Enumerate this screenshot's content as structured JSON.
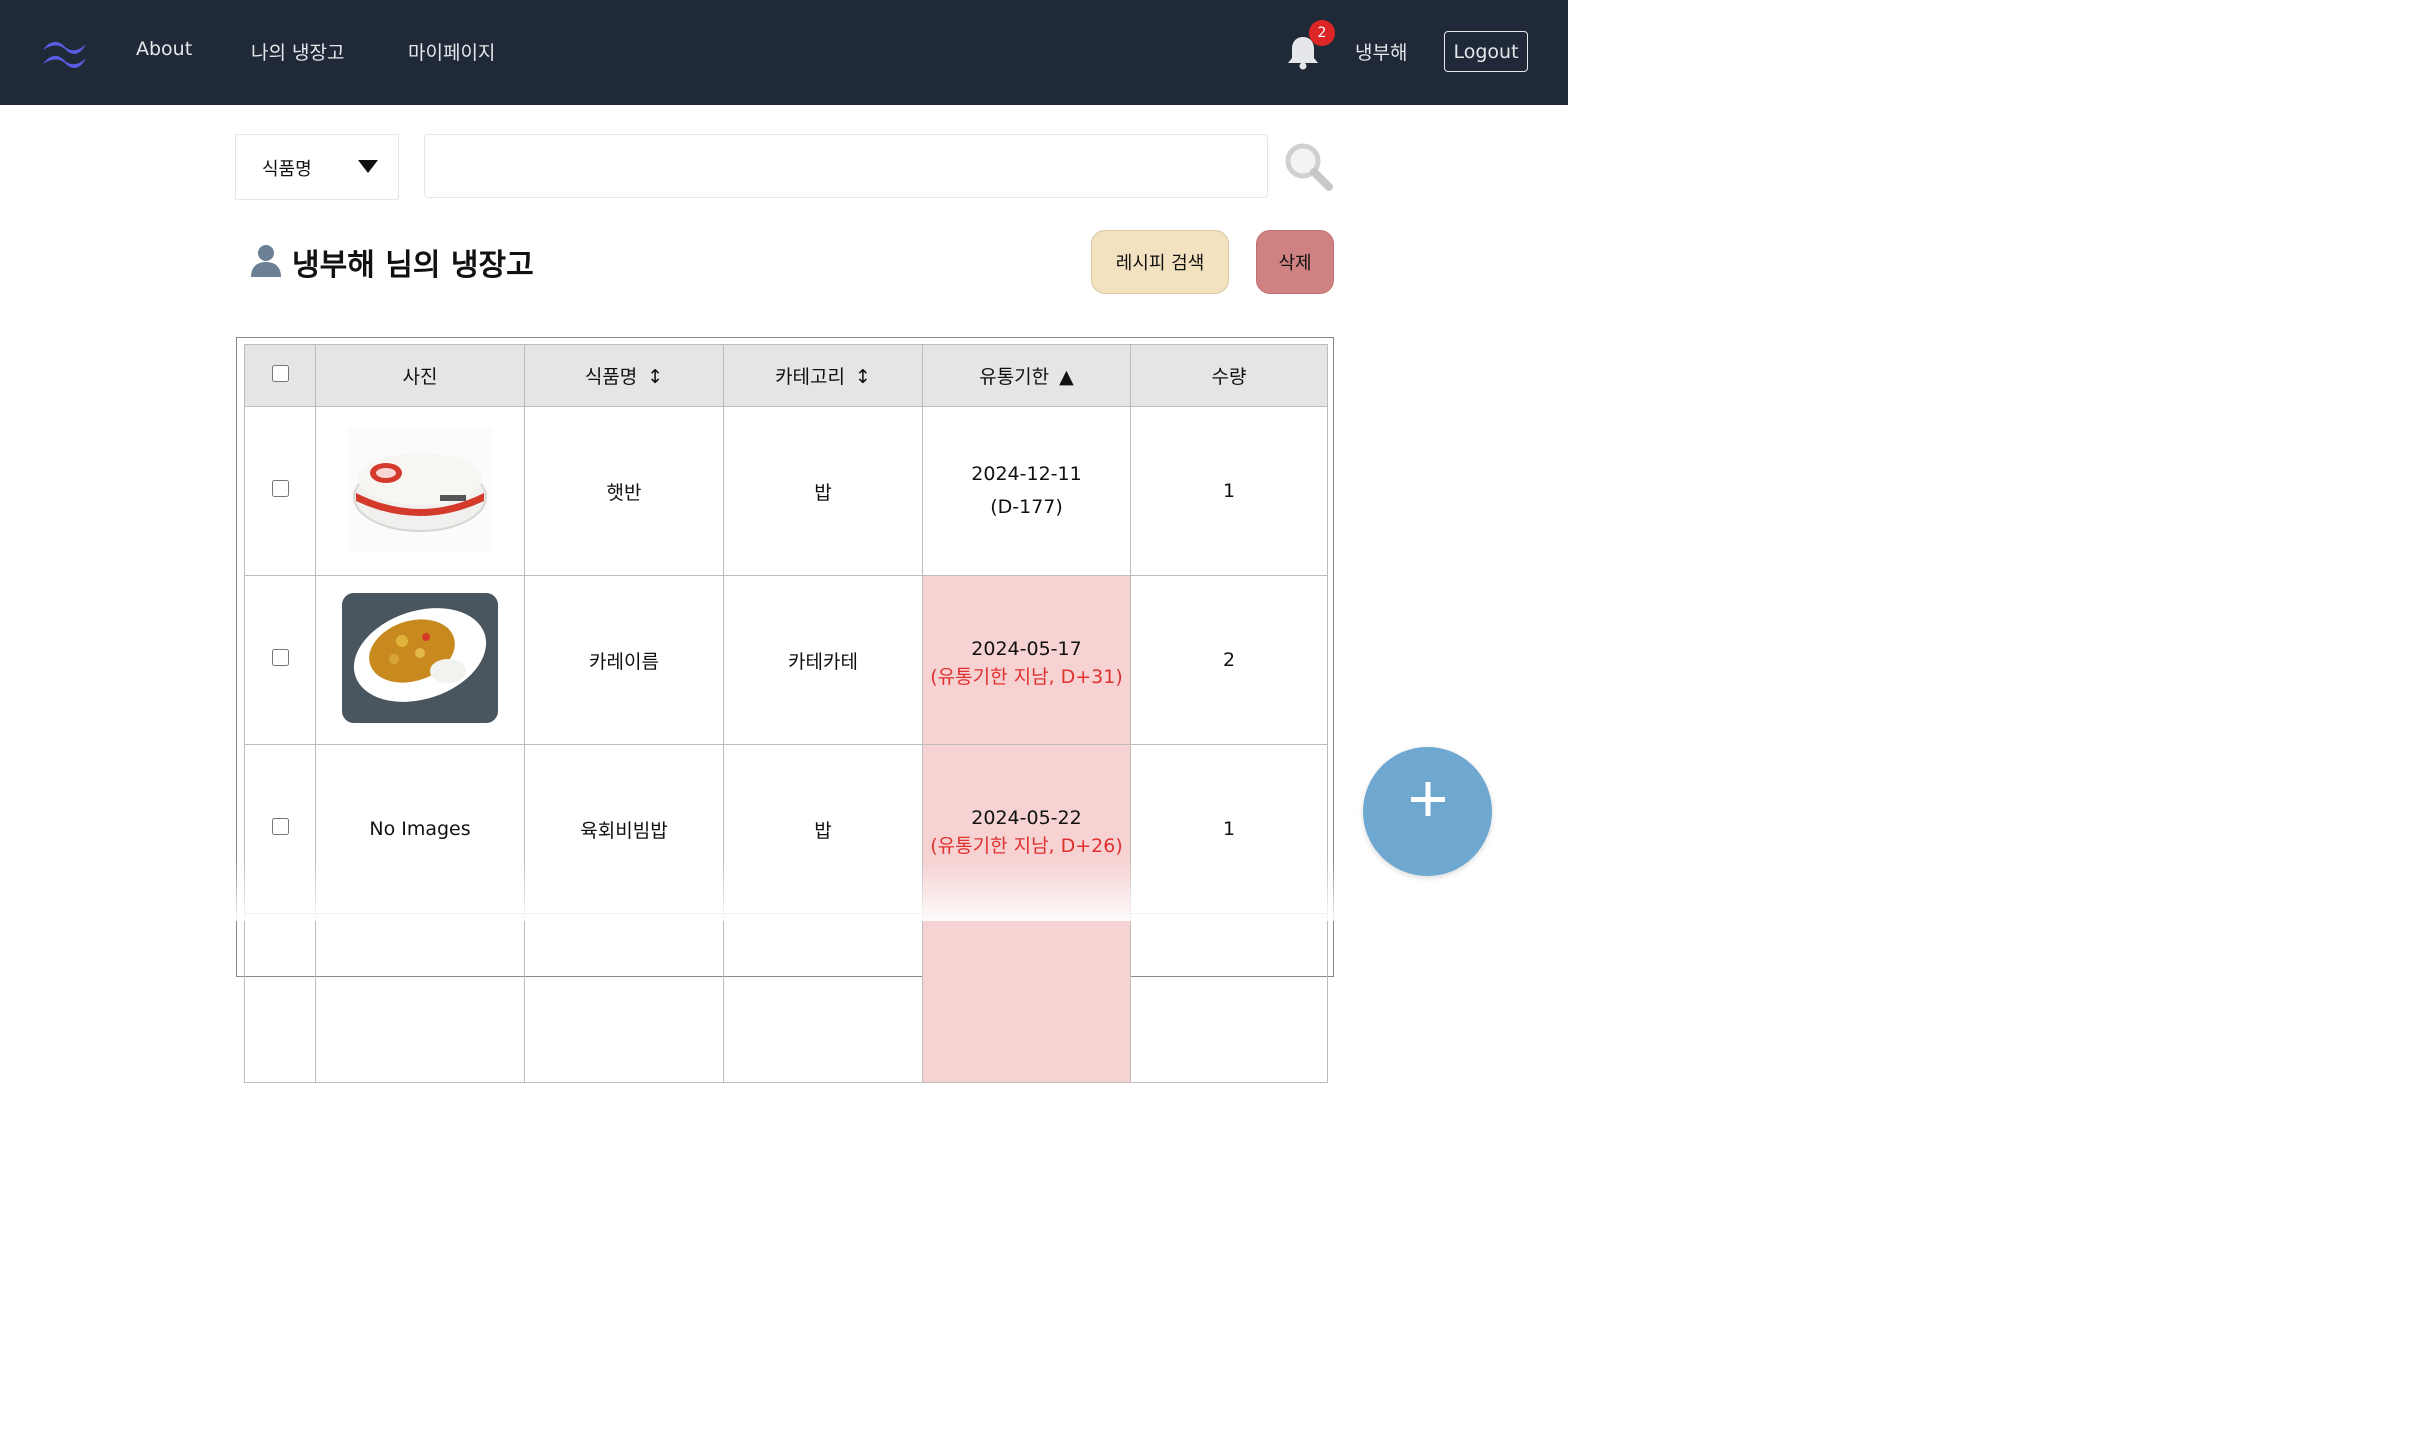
{
  "nav": {
    "links": [
      "About",
      "나의 냉장고",
      "마이페이지"
    ],
    "notification_count": "2",
    "username": "냉부해",
    "logout_label": "Logout"
  },
  "search": {
    "filter_selected": "식품명",
    "query": "",
    "placeholder": ""
  },
  "page": {
    "title": "냉부해 님의 냉장고",
    "recipe_button": "레시피 검색",
    "delete_button": "삭제"
  },
  "table": {
    "headers": {
      "photo": "사진",
      "name": "식품명",
      "category": "카테고리",
      "expiry": "유통기한",
      "quantity": "수량"
    },
    "sort_icons": {
      "name": "↕",
      "category": "↕",
      "expiry": "▲"
    },
    "rows": [
      {
        "image": "rice-bowl-image",
        "name": "햇반",
        "category": "밥",
        "date": "2024-12-11",
        "note": "(D-177)",
        "expired": false,
        "quantity": "1"
      },
      {
        "image": "curry-plate-image",
        "name": "카레이름",
        "category": "카테카테",
        "date": "2024-05-17",
        "note": "(유통기한 지남, D+31)",
        "expired": true,
        "quantity": "2"
      },
      {
        "image": "",
        "no_image_text": "No Images",
        "name": "육회비빔밥",
        "category": "밥",
        "date": "2024-05-22",
        "note": "(유통기한 지남, D+26)",
        "expired": true,
        "quantity": "1"
      }
    ]
  },
  "colors": {
    "nav_bg": "#1f2937",
    "expired_bg": "#f6d2d2",
    "expired_text": "#e03131",
    "recipe_btn": "#f3e2c0",
    "delete_btn": "#d08282",
    "fab": "#6ea7d0",
    "logo": "#5a5ce8"
  },
  "icons": {
    "logo": "wind-waves-logo",
    "bell": "bell-icon",
    "search": "magnifier-icon",
    "user": "user-silhouette-icon",
    "fab": "plus-icon"
  }
}
